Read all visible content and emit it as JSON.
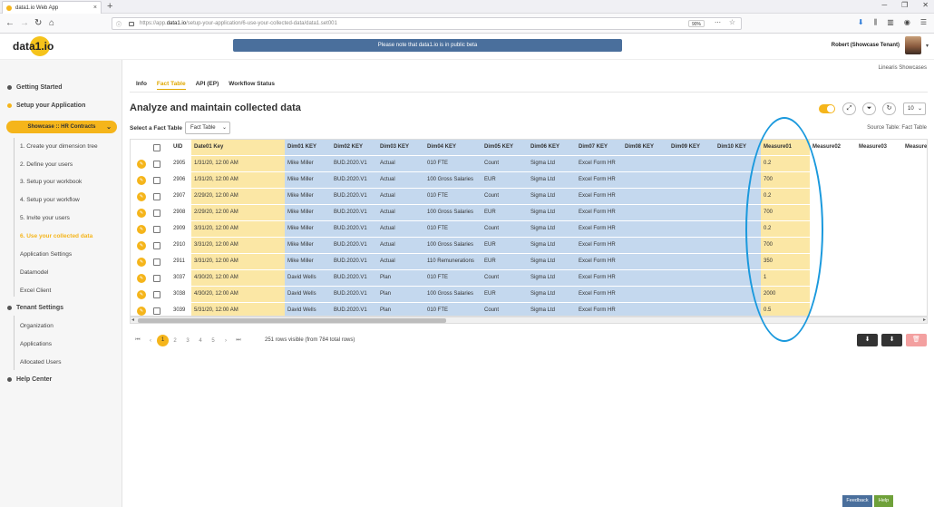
{
  "browser": {
    "tab_title": "data1.io Web App",
    "tab_close": "×",
    "new_tab": "+",
    "url_prefix": "https://app.",
    "url_host": "data1.io",
    "url_path": "/setup-your-application/6-use-your-collected-data/data1.set001",
    "zoom": "90%"
  },
  "header": {
    "logo": "data1.io",
    "beta_notice": "Please note that data1.io is in public beta",
    "user_name": "Robert (Showcase Tenant)",
    "tenant_label": "Linearis Showcases"
  },
  "sidebar": {
    "getting_started": "Getting Started",
    "setup_application": "Setup your Application",
    "tenant_selector": "Showcase :: HR Contracts",
    "steps": [
      {
        "label": "1. Create your dimension tree"
      },
      {
        "label": "2. Define your users"
      },
      {
        "label": "3. Setup your workbook"
      },
      {
        "label": "4. Setup your workflow"
      },
      {
        "label": "5. Invite your users"
      },
      {
        "label": "6. Use your collected data"
      }
    ],
    "extra_items": [
      {
        "label": "Application Settings"
      },
      {
        "label": "Datamodel"
      },
      {
        "label": "Excel Client"
      }
    ],
    "tenant_settings": "Tenant Settings",
    "tenant_items": [
      {
        "label": "Organization"
      },
      {
        "label": "Applications"
      },
      {
        "label": "Allocated Users"
      }
    ],
    "help_center": "Help Center"
  },
  "main": {
    "tabs": [
      {
        "label": "Info"
      },
      {
        "label": "Fact Table"
      },
      {
        "label": "API (EP)"
      },
      {
        "label": "Workflow Status"
      }
    ],
    "active_tab": "Fact Table",
    "title": "Analyze and maintain collected data",
    "select_fact_label": "Select a Fact Table",
    "select_fact_value": "Fact Table",
    "source_table": "Source Table: Fact Table",
    "rows_per_page": "10",
    "toggle_on": true
  },
  "table": {
    "columns": [
      "UID",
      "Date01 Key",
      "Dim01 KEY",
      "Dim02 KEY",
      "Dim03 KEY",
      "Dim04 KEY",
      "Dim05 KEY",
      "Dim06 KEY",
      "Dim07 KEY",
      "Dim08 KEY",
      "Dim09 KEY",
      "Dim10 KEY",
      "Measure01",
      "Measure02",
      "Measure03",
      "Measure"
    ],
    "rows": [
      [
        "2905",
        "1/31/20, 12:00 AM",
        "Mike Miller",
        "BUD.2020.V1",
        "Actual",
        "010 FTE",
        "Count",
        "Sigma Ltd",
        "Excel Form HR",
        "",
        "",
        "",
        "0.2",
        "",
        "",
        ""
      ],
      [
        "2906",
        "1/31/20, 12:00 AM",
        "Mike Miller",
        "BUD.2020.V1",
        "Actual",
        "100 Gross Salaries",
        "EUR",
        "Sigma Ltd",
        "Excel Form HR",
        "",
        "",
        "",
        "700",
        "",
        "",
        ""
      ],
      [
        "2907",
        "2/29/20, 12:00 AM",
        "Mike Miller",
        "BUD.2020.V1",
        "Actual",
        "010 FTE",
        "Count",
        "Sigma Ltd",
        "Excel Form HR",
        "",
        "",
        "",
        "0.2",
        "",
        "",
        ""
      ],
      [
        "2908",
        "2/29/20, 12:00 AM",
        "Mike Miller",
        "BUD.2020.V1",
        "Actual",
        "100 Gross Salaries",
        "EUR",
        "Sigma Ltd",
        "Excel Form HR",
        "",
        "",
        "",
        "700",
        "",
        "",
        ""
      ],
      [
        "2909",
        "3/31/20, 12:00 AM",
        "Mike Miller",
        "BUD.2020.V1",
        "Actual",
        "010 FTE",
        "Count",
        "Sigma Ltd",
        "Excel Form HR",
        "",
        "",
        "",
        "0.2",
        "",
        "",
        ""
      ],
      [
        "2910",
        "3/31/20, 12:00 AM",
        "Mike Miller",
        "BUD.2020.V1",
        "Actual",
        "100 Gross Salaries",
        "EUR",
        "Sigma Ltd",
        "Excel Form HR",
        "",
        "",
        "",
        "700",
        "",
        "",
        ""
      ],
      [
        "2911",
        "3/31/20, 12:00 AM",
        "Mike Miller",
        "BUD.2020.V1",
        "Actual",
        "110 Remunerations",
        "EUR",
        "Sigma Ltd",
        "Excel Form HR",
        "",
        "",
        "",
        "350",
        "",
        "",
        ""
      ],
      [
        "3037",
        "4/30/20, 12:00 AM",
        "David Wells",
        "BUD.2020.V1",
        "Plan",
        "010 FTE",
        "Count",
        "Sigma Ltd",
        "Excel Form HR",
        "",
        "",
        "",
        "1",
        "",
        "",
        ""
      ],
      [
        "3038",
        "4/30/20, 12:00 AM",
        "David Wells",
        "BUD.2020.V1",
        "Plan",
        "100 Gross Salaries",
        "EUR",
        "Sigma Ltd",
        "Excel Form HR",
        "",
        "",
        "",
        "2000",
        "",
        "",
        ""
      ],
      [
        "3039",
        "5/31/20, 12:00 AM",
        "David Wells",
        "BUD.2020.V1",
        "Plan",
        "010 FTE",
        "Count",
        "Sigma Ltd",
        "Excel Form HR",
        "",
        "",
        "",
        "0.5",
        "",
        "",
        ""
      ]
    ],
    "edit_icon_glyph": "✎"
  },
  "pagination": {
    "first": "⏮",
    "prev": "‹",
    "pages": [
      "1",
      "2",
      "3",
      "4",
      "5"
    ],
    "current": "1",
    "next": "›",
    "last": "⏭",
    "rows_info": "251 rows visible (from 784 total rows)"
  },
  "actions": {
    "download1": "⬇",
    "download2": "⬇",
    "delete": "🗑"
  },
  "footer": {
    "feedback": "Feedback",
    "help": "Help"
  },
  "colors": {
    "accent": "#f5b51b",
    "beta_bar": "#4a6f9c",
    "date_column": "#fbe7a5",
    "dim_columns": "#c4d8ee",
    "annotation": "#1a99dd",
    "help": "#6fa13a"
  }
}
